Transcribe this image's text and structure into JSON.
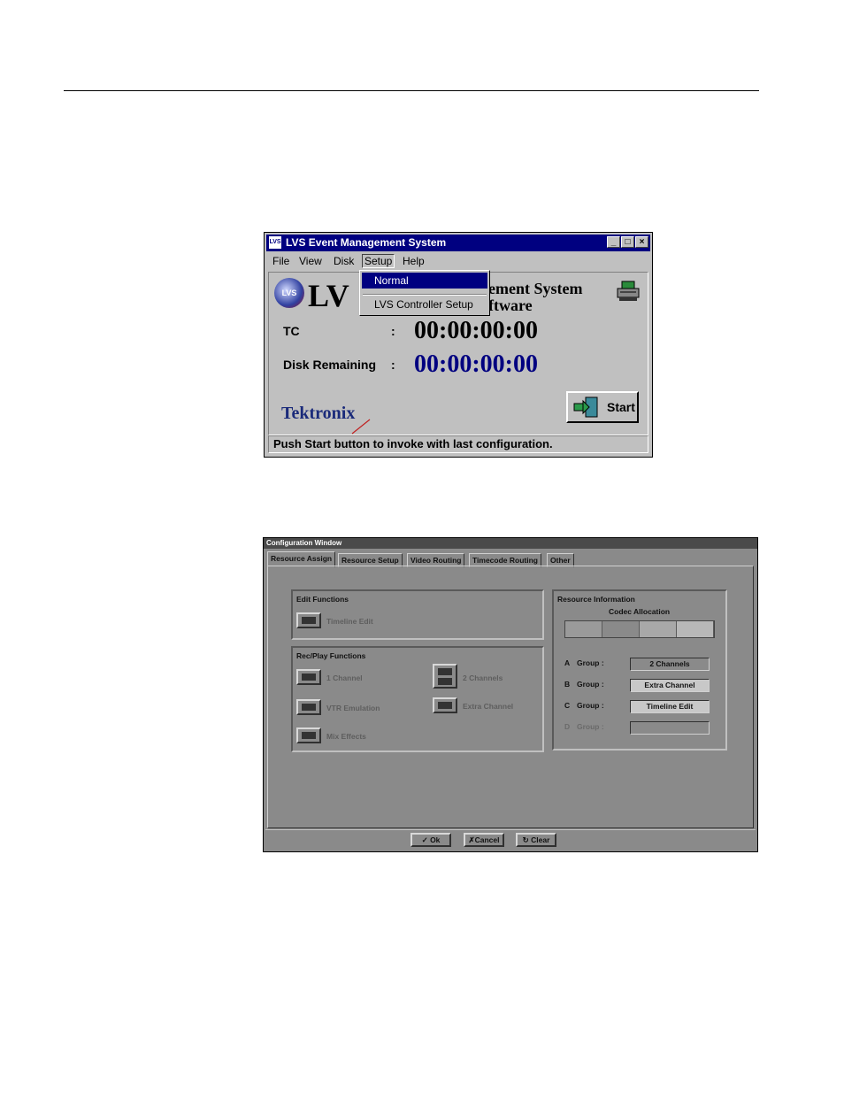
{
  "main_window": {
    "title": "LVS Event Management System",
    "title_logo": "LVS",
    "window_controls": [
      "minimize",
      "maximize",
      "close"
    ],
    "menu": [
      "File",
      "View",
      "Disk",
      "Setup",
      "Help"
    ],
    "active_menu": "Setup",
    "setup_menu": {
      "items": [
        "Normal",
        "LVS Controller Setup"
      ],
      "highlighted": "Normal"
    },
    "logo_text": "LVS",
    "heading_left": "LV",
    "heading_right_line1": "ement System",
    "heading_right_line2": "ftware",
    "tc_label": "TC",
    "tc_colon": ":",
    "tc_value": "00:00:00:00",
    "disk_label": "Disk Remaining",
    "disk_colon": ":",
    "disk_value": "00:00:00:00",
    "brand": "Tektronix",
    "start_label": "Start",
    "status_text": "Push Start button to invoke with last configuration.",
    "colors": {
      "titlebar": "#000080",
      "disk_value": "#000080",
      "face": "#c0c0c0"
    }
  },
  "config_window": {
    "title": "Configuration Window",
    "tabs": [
      "Resource Assign",
      "Resource Setup",
      "Video Routing",
      "Timecode Routing",
      "Other"
    ],
    "active_tab": "Resource Assign",
    "edit_functions": {
      "title": "Edit Functions",
      "items": [
        "Timeline Edit"
      ]
    },
    "recplay_functions": {
      "title": "Rec/Play Functions",
      "items": [
        "1 Channel",
        "VTR Emulation",
        "Mix Effects",
        "2 Channels",
        "Extra Channel"
      ]
    },
    "resource_info": {
      "title": "Resource Information",
      "codec_label": "Codec Allocation",
      "groups": [
        {
          "letter": "A",
          "label": "Group :",
          "value": "2 Channels"
        },
        {
          "letter": "B",
          "label": "Group :",
          "value": "Extra Channel"
        },
        {
          "letter": "C",
          "label": "Group :",
          "value": "Timeline Edit"
        },
        {
          "letter": "D",
          "label": "Group :",
          "value": ""
        }
      ]
    },
    "buttons": {
      "ok": "Ok",
      "cancel": "Cancel",
      "clear": "Clear"
    }
  }
}
